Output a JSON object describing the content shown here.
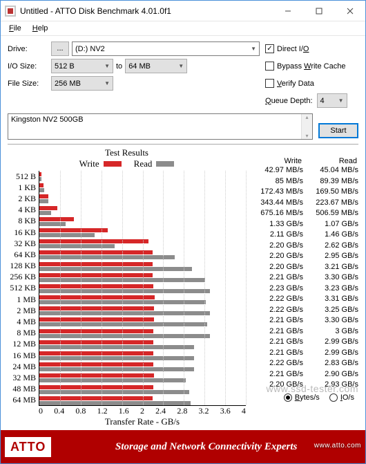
{
  "window": {
    "title": "Untitled - ATTO Disk Benchmark 4.01.0f1"
  },
  "menu": {
    "file": "File",
    "help": "Help"
  },
  "labels": {
    "drive": "Drive:",
    "iosize": "I/O Size:",
    "to": "to",
    "filesize": "File Size:",
    "directio": "Direct I/O",
    "bypass": "Bypass Write Cache",
    "verify": "Verify Data",
    "queuedepth": "Queue Depth:",
    "start": "Start",
    "testresults": "Test Results",
    "write": "Write",
    "read": "Read",
    "xlabel": "Transfer Rate - GB/s",
    "bytesps": "Bytes/s",
    "iops": "IO/s",
    "browse": "...",
    "tagline": "Storage and Network Connectivity Experts",
    "url": "www.atto.com",
    "brand": "ATTO",
    "watermark": "www.ssd-tester.com"
  },
  "values": {
    "drive": "(D:) NV2",
    "iosize_from": "512 B",
    "iosize_to": "64 MB",
    "filesize": "256 MB",
    "queuedepth": "4",
    "description": "Kingston NV2 500GB",
    "directio_checked": true,
    "bypass_checked": false,
    "verify_checked": false,
    "unit_selected": "bytes"
  },
  "chart_data": {
    "type": "bar",
    "orientation": "horizontal",
    "title": "Test Results",
    "xlabel": "Transfer Rate - GB/s",
    "xlim": [
      0,
      4
    ],
    "xticks": [
      0,
      0.4,
      0.8,
      1.2,
      1.6,
      2,
      2.4,
      2.8,
      3.2,
      3.6,
      4
    ],
    "categories": [
      "512 B",
      "1 KB",
      "2 KB",
      "4 KB",
      "8 KB",
      "16 KB",
      "32 KB",
      "64 KB",
      "128 KB",
      "256 KB",
      "512 KB",
      "1 MB",
      "2 MB",
      "4 MB",
      "8 MB",
      "12 MB",
      "16 MB",
      "24 MB",
      "32 MB",
      "48 MB",
      "64 MB"
    ],
    "series": [
      {
        "name": "Write",
        "color": "#d62728",
        "unit": "GB/s",
        "values": [
          0.04297,
          0.085,
          0.17243,
          0.34344,
          0.67516,
          1.33,
          2.11,
          2.2,
          2.2,
          2.2,
          2.21,
          2.23,
          2.22,
          2.22,
          2.21,
          2.21,
          2.21,
          2.21,
          2.22,
          2.21,
          2.2
        ]
      },
      {
        "name": "Read",
        "color": "#8c8c8c",
        "unit": "GB/s",
        "values": [
          0.04504,
          0.08939,
          0.1695,
          0.22367,
          0.50659,
          1.07,
          1.46,
          2.62,
          2.95,
          3.21,
          3.3,
          3.23,
          3.31,
          3.25,
          3.3,
          3.0,
          2.99,
          2.99,
          2.83,
          2.9,
          2.93
        ]
      }
    ],
    "display": [
      {
        "write": "42.97 MB/s",
        "read": "45.04 MB/s"
      },
      {
        "write": "85 MB/s",
        "read": "89.39 MB/s"
      },
      {
        "write": "172.43 MB/s",
        "read": "169.50 MB/s"
      },
      {
        "write": "343.44 MB/s",
        "read": "223.67 MB/s"
      },
      {
        "write": "675.16 MB/s",
        "read": "506.59 MB/s"
      },
      {
        "write": "1.33 GB/s",
        "read": "1.07 GB/s"
      },
      {
        "write": "2.11 GB/s",
        "read": "1.46 GB/s"
      },
      {
        "write": "2.20 GB/s",
        "read": "2.62 GB/s"
      },
      {
        "write": "2.20 GB/s",
        "read": "2.95 GB/s"
      },
      {
        "write": "2.20 GB/s",
        "read": "3.21 GB/s"
      },
      {
        "write": "2.21 GB/s",
        "read": "3.30 GB/s"
      },
      {
        "write": "2.23 GB/s",
        "read": "3.23 GB/s"
      },
      {
        "write": "2.22 GB/s",
        "read": "3.31 GB/s"
      },
      {
        "write": "2.22 GB/s",
        "read": "3.25 GB/s"
      },
      {
        "write": "2.21 GB/s",
        "read": "3.30 GB/s"
      },
      {
        "write": "2.21 GB/s",
        "read": "3 GB/s"
      },
      {
        "write": "2.21 GB/s",
        "read": "2.99 GB/s"
      },
      {
        "write": "2.21 GB/s",
        "read": "2.99 GB/s"
      },
      {
        "write": "2.22 GB/s",
        "read": "2.83 GB/s"
      },
      {
        "write": "2.21 GB/s",
        "read": "2.90 GB/s"
      },
      {
        "write": "2.20 GB/s",
        "read": "2.93 GB/s"
      }
    ]
  }
}
